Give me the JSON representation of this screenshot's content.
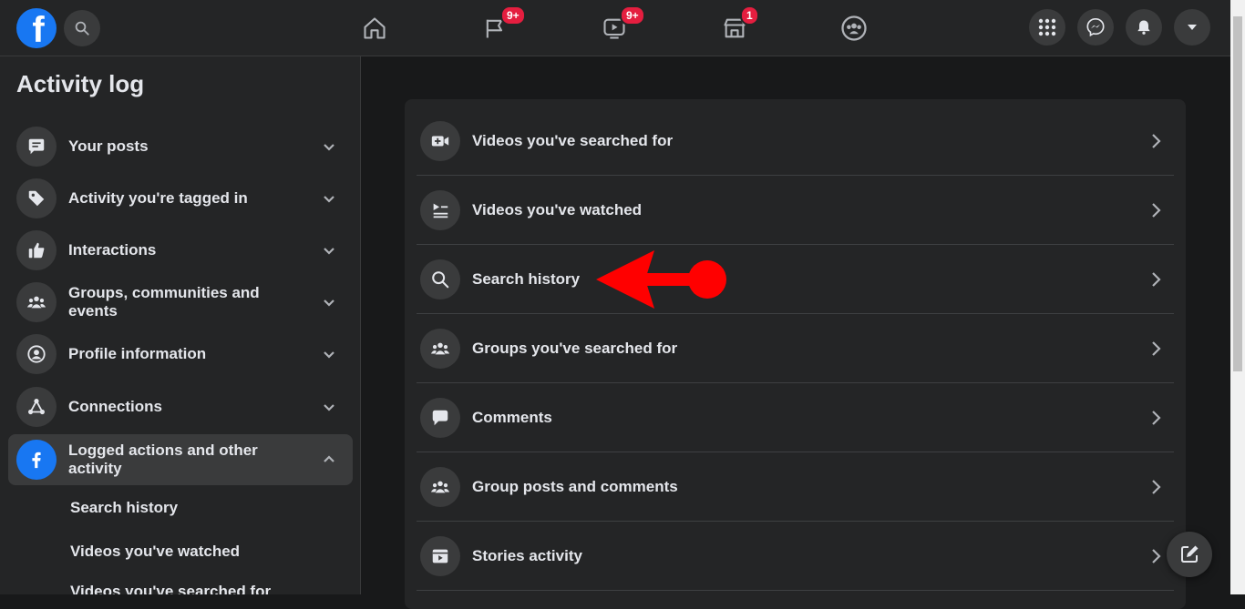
{
  "topbar": {
    "logo": "f",
    "nav": [
      {
        "icon": "home-icon",
        "badge": ""
      },
      {
        "icon": "flag-icon",
        "badge": "9+"
      },
      {
        "icon": "watch-video-icon",
        "badge": "9+"
      },
      {
        "icon": "marketplace-icon",
        "badge": "1"
      },
      {
        "icon": "groups-icon",
        "badge": ""
      }
    ],
    "right_icons": [
      "menu-grid-icon",
      "messenger-icon",
      "notifications-bell-icon",
      "account-caret-icon"
    ]
  },
  "sidebar": {
    "title": "Activity log",
    "items": [
      {
        "label": "Your posts",
        "icon": "posts-icon",
        "expanded": false
      },
      {
        "label": "Activity you're tagged in",
        "icon": "tag-icon",
        "expanded": false
      },
      {
        "label": "Interactions",
        "icon": "thumbs-up-icon",
        "expanded": false
      },
      {
        "label": "Groups, communities and events",
        "icon": "groups-icon",
        "expanded": false
      },
      {
        "label": "Profile information",
        "icon": "profile-icon",
        "expanded": false
      },
      {
        "label": "Connections",
        "icon": "connections-icon",
        "expanded": false
      },
      {
        "label": "Logged actions and other activity",
        "icon": "facebook-icon",
        "expanded": true
      }
    ],
    "sub_items": [
      "Search history",
      "Videos you've watched",
      "Videos you've searched for"
    ]
  },
  "main": {
    "rows": [
      {
        "label": "Videos you've searched for",
        "icon": "video-plus-icon"
      },
      {
        "label": "Videos you've watched",
        "icon": "playlist-icon"
      },
      {
        "label": "Search history",
        "icon": "search-icon"
      },
      {
        "label": "Groups you've searched for",
        "icon": "groups-icon"
      },
      {
        "label": "Comments",
        "icon": "comment-icon"
      },
      {
        "label": "Group posts and comments",
        "icon": "groups-icon"
      },
      {
        "label": "Stories activity",
        "icon": "stories-icon"
      }
    ]
  },
  "colors": {
    "accent": "#1877f2",
    "badge": "#e41e3f",
    "annotation_arrow": "#ff0000"
  }
}
